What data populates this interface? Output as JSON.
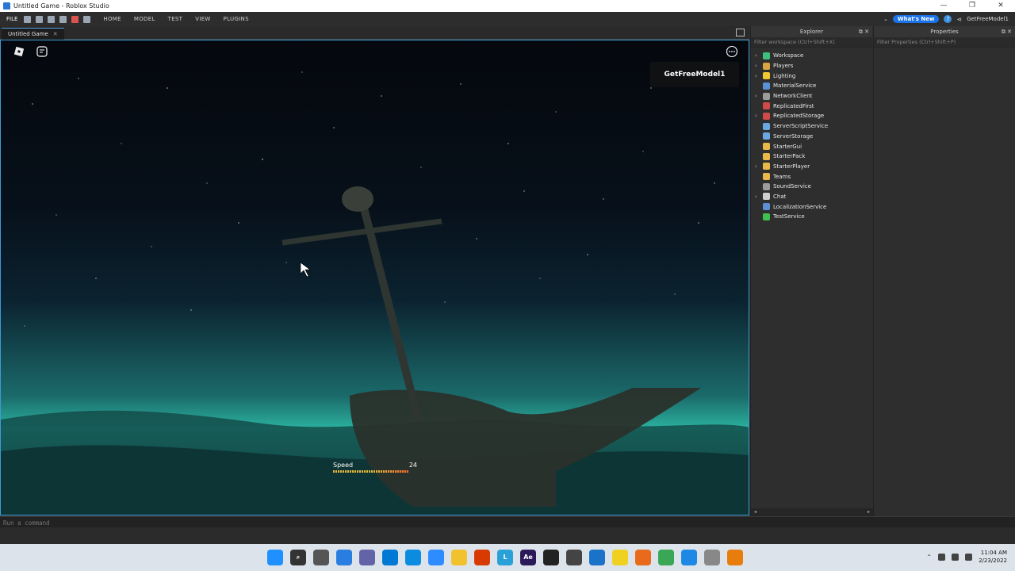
{
  "window": {
    "title": "Untitled Game - Roblox Studio",
    "controls": [
      "—",
      "❐",
      "✕"
    ]
  },
  "menu": {
    "file": "FILE",
    "tabs": [
      "HOME",
      "MODEL",
      "TEST",
      "VIEW",
      "PLUGINS"
    ],
    "whats_new": "What's New",
    "user": "GetFreeModel1"
  },
  "doc_tab": {
    "label": "Untitled Game",
    "close": "✕"
  },
  "viewport": {
    "model_button": "GetFreeModel1",
    "speed_label": "Speed",
    "speed_value": "24"
  },
  "command": {
    "placeholder": "Run a command"
  },
  "explorer": {
    "title": "Explorer",
    "filter": "Filter workspace (Ctrl+Shift+X)",
    "items": [
      {
        "label": "Workspace",
        "expandable": true,
        "color": "#3fbf7f"
      },
      {
        "label": "Players",
        "expandable": true,
        "color": "#d9a441"
      },
      {
        "label": "Lighting",
        "expandable": true,
        "color": "#f0c930"
      },
      {
        "label": "MaterialService",
        "expandable": false,
        "color": "#5b8fd6"
      },
      {
        "label": "NetworkClient",
        "expandable": true,
        "color": "#9c9c9c"
      },
      {
        "label": "ReplicatedFirst",
        "expandable": false,
        "color": "#d04a4a"
      },
      {
        "label": "ReplicatedStorage",
        "expandable": true,
        "color": "#d04a4a"
      },
      {
        "label": "ServerScriptService",
        "expandable": false,
        "color": "#6aa6e0"
      },
      {
        "label": "ServerStorage",
        "expandable": false,
        "color": "#6aa6e0"
      },
      {
        "label": "StarterGui",
        "expandable": false,
        "color": "#e8b84a"
      },
      {
        "label": "StarterPack",
        "expandable": false,
        "color": "#e8b84a"
      },
      {
        "label": "StarterPlayer",
        "expandable": true,
        "color": "#e8b84a"
      },
      {
        "label": "Teams",
        "expandable": false,
        "color": "#e8b84a"
      },
      {
        "label": "SoundService",
        "expandable": false,
        "color": "#9c9c9c"
      },
      {
        "label": "Chat",
        "expandable": true,
        "color": "#cfcfcf"
      },
      {
        "label": "LocalizationService",
        "expandable": false,
        "color": "#5b8fd6"
      },
      {
        "label": "TestService",
        "expandable": false,
        "color": "#3fbf4f"
      }
    ]
  },
  "properties": {
    "title": "Properties",
    "filter": "Filter Properties (Ctrl+Shift+P)"
  },
  "taskbar": {
    "apps": [
      {
        "name": "windows-start-icon",
        "glyph": "",
        "color": "#1e90ff"
      },
      {
        "name": "search-icon",
        "glyph": "⌕",
        "color": "#333333"
      },
      {
        "name": "task-view-icon",
        "glyph": "",
        "color": "#555555"
      },
      {
        "name": "widgets-icon",
        "glyph": "",
        "color": "#2a7de1"
      },
      {
        "name": "chat-app-icon",
        "glyph": "",
        "color": "#6264a7"
      },
      {
        "name": "vscode-icon",
        "glyph": "",
        "color": "#0078d4"
      },
      {
        "name": "edge-icon",
        "glyph": "",
        "color": "#0c8ce0"
      },
      {
        "name": "zoom-icon",
        "glyph": "",
        "color": "#2d8cff"
      },
      {
        "name": "file-explorer-icon",
        "glyph": "",
        "color": "#f2c12e"
      },
      {
        "name": "office-icon",
        "glyph": "",
        "color": "#d83b01"
      },
      {
        "name": "lightshot-icon",
        "glyph": "L",
        "color": "#2aa0d8"
      },
      {
        "name": "after-effects-icon",
        "glyph": "Ae",
        "color": "#2b1a5a"
      },
      {
        "name": "epic-games-icon",
        "glyph": "",
        "color": "#222222"
      },
      {
        "name": "obs-icon",
        "glyph": "",
        "color": "#444444"
      },
      {
        "name": "mail-icon",
        "glyph": "",
        "color": "#1a73c8"
      },
      {
        "name": "sticky-notes-icon",
        "glyph": "",
        "color": "#f0d020"
      },
      {
        "name": "fl-studio-icon",
        "glyph": "",
        "color": "#e86a1a"
      },
      {
        "name": "chrome-icon",
        "glyph": "",
        "color": "#3aa757"
      },
      {
        "name": "roblox-studio-icon",
        "glyph": "",
        "color": "#1e88e5"
      },
      {
        "name": "roblox-icon",
        "glyph": "",
        "color": "#888888"
      },
      {
        "name": "blender-icon",
        "glyph": "",
        "color": "#e87d0d"
      }
    ],
    "time": "11:04 AM",
    "date": "2/23/2022"
  }
}
